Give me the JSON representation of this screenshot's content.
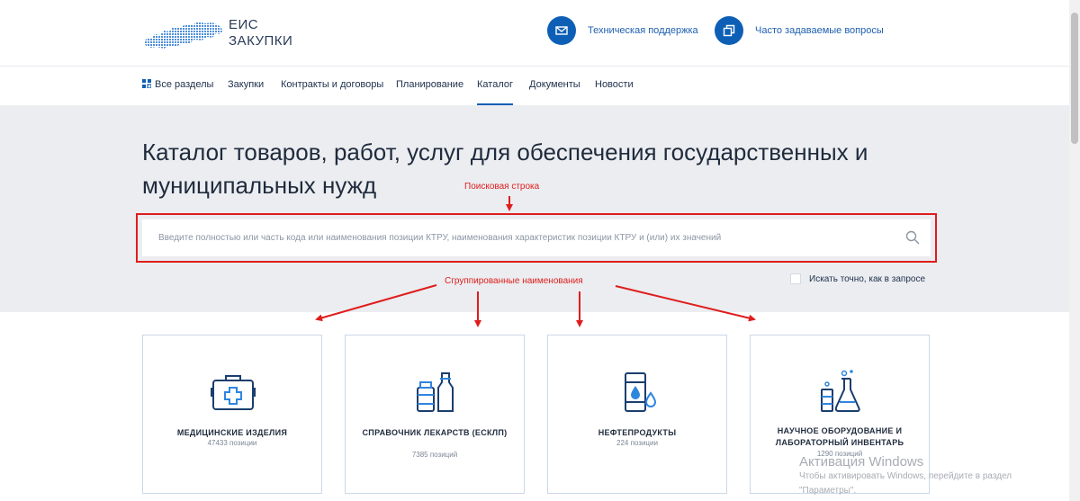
{
  "header": {
    "logo_line1": "ЕИС",
    "logo_line2": "ЗАКУПКИ",
    "support_label": "Техническая поддержка",
    "faq_label": "Часто задаваемые вопросы"
  },
  "nav": {
    "items": [
      {
        "label": "Все разделы"
      },
      {
        "label": "Закупки"
      },
      {
        "label": "Контракты и договоры"
      },
      {
        "label": "Планирование"
      },
      {
        "label": "Каталог",
        "active": true
      },
      {
        "label": "Документы"
      },
      {
        "label": "Новости"
      }
    ]
  },
  "hero": {
    "title": "Каталог товаров, работ, услуг для обеспечения государственных и муниципальных нужд",
    "search_placeholder": "Введите полностью или часть кода или наименования позиции КТРУ, наименования характеристик позиции КТРУ и (или) их значений",
    "exact_label": "Искать точно, как в запросе"
  },
  "annotations": {
    "search": "Поисковая строка",
    "groups": "Сгруппированные наименования"
  },
  "cards": [
    {
      "title": "МЕДИЦИНСКИЕ ИЗДЕЛИЯ",
      "count": "47433 позиции"
    },
    {
      "title": "СПРАВОЧНИК ЛЕКАРСТВ (ЕСКЛП)",
      "count": "7385 позиций"
    },
    {
      "title": "НЕФТЕПРОДУКТЫ",
      "count": "224 позиции"
    },
    {
      "title": "НАУЧНОЕ ОБОРУДОВАНИЕ И ЛАБОРАТОРНЫЙ ИНВЕНТАРЬ",
      "count": "1290 позиций"
    }
  ],
  "watermark": {
    "line1": "Активация Windows",
    "line2": "Чтобы активировать Windows, перейдите в раздел",
    "line3": "\"Параметры\"."
  },
  "colors": {
    "accent": "#0d5fb6",
    "annotation": "#e01d1d",
    "hero_bg": "#ebedf0"
  }
}
